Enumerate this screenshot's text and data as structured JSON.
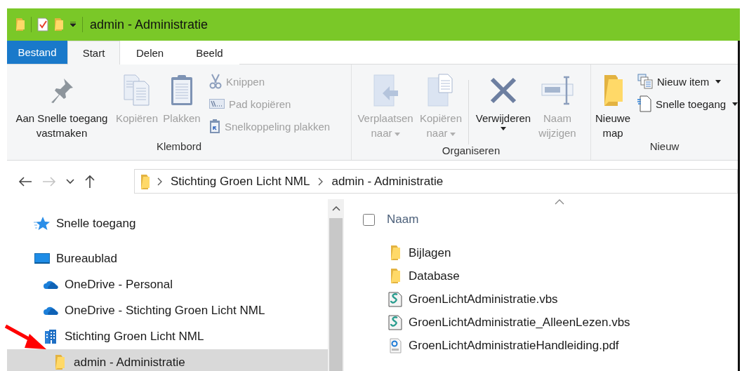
{
  "title_bar": {
    "title": "admin - Administratie"
  },
  "ribbon_tabs": [
    {
      "label": "Bestand",
      "kind": "file",
      "selected": false
    },
    {
      "label": "Start",
      "kind": "tab",
      "selected": true
    },
    {
      "label": "Delen",
      "kind": "tab",
      "selected": false
    },
    {
      "label": "Beeld",
      "kind": "tab",
      "selected": false
    }
  ],
  "ribbon_groups": [
    {
      "label": "Klembord",
      "items": [
        {
          "kind": "large",
          "label": "Aan Snelle toegang vastmaken",
          "disabled": false,
          "dropdown": false
        },
        {
          "kind": "large",
          "label": "Kopiëren",
          "disabled": true,
          "dropdown": false
        },
        {
          "kind": "large",
          "label": "Plakken",
          "disabled": true,
          "dropdown": false
        },
        {
          "kind": "small",
          "label": "Knippen",
          "disabled": true,
          "dropdown": false
        },
        {
          "kind": "small",
          "label": "Pad kopiëren",
          "disabled": true,
          "dropdown": false
        },
        {
          "kind": "small",
          "label": "Snelkoppeling plakken",
          "disabled": true,
          "dropdown": false
        }
      ]
    },
    {
      "label": "Organiseren",
      "items": [
        {
          "kind": "large",
          "label": "Verplaatsen naar",
          "disabled": true,
          "dropdown": true
        },
        {
          "kind": "large",
          "label": "Kopiëren naar",
          "disabled": true,
          "dropdown": true
        },
        {
          "kind": "separator"
        },
        {
          "kind": "large",
          "label": "Verwijderen",
          "disabled": false,
          "dropdown": true
        },
        {
          "kind": "large",
          "label": "Naam wijzigen",
          "disabled": true,
          "dropdown": false
        }
      ]
    },
    {
      "label": "Nieuw",
      "items": [
        {
          "kind": "large",
          "label": "Nieuwe map",
          "disabled": false,
          "dropdown": false
        },
        {
          "kind": "small",
          "label": "Nieuw item",
          "disabled": false,
          "dropdown": true
        },
        {
          "kind": "small",
          "label": "Snelle toegang",
          "disabled": false,
          "dropdown": true
        }
      ]
    }
  ],
  "navigation": [
    {
      "kind": "back",
      "disabled": false
    },
    {
      "kind": "forward",
      "disabled": true
    },
    {
      "kind": "recent",
      "disabled": false
    },
    {
      "kind": "up",
      "disabled": false
    }
  ],
  "address_bar": {
    "path": [
      "Stichting Groen Licht NML",
      "admin - Administratie"
    ]
  },
  "nav_pane": {
    "items": [
      {
        "label": "Snelle toegang",
        "kind": "quick-access",
        "selected": false
      },
      {
        "label": "Bureaublad",
        "kind": "desktop",
        "selected": false,
        "children": [
          {
            "label": "OneDrive - Personal",
            "kind": "cloud",
            "selected": false
          },
          {
            "label": "OneDrive - Stichting Groen Licht NML",
            "kind": "cloud",
            "selected": false
          },
          {
            "label": "Stichting Groen Licht NML",
            "kind": "organization",
            "selected": false,
            "children": [
              {
                "label": "admin - Administratie",
                "kind": "folder",
                "selected": true
              }
            ]
          }
        ]
      }
    ]
  },
  "file_list": {
    "header": {
      "label": "Naam",
      "checked": false,
      "sort_ascending": true
    },
    "files": [
      {
        "name": "Bijlagen",
        "kind": "folder"
      },
      {
        "name": "Database",
        "kind": "folder"
      },
      {
        "name": "GroenLichtAdministratie.vbs",
        "kind": "script"
      },
      {
        "name": "GroenLichtAdministratie_AlleenLezen.vbs",
        "kind": "script"
      },
      {
        "name": "GroenLichtAdministratieHandleiding.pdf",
        "kind": "pdf"
      }
    ]
  }
}
